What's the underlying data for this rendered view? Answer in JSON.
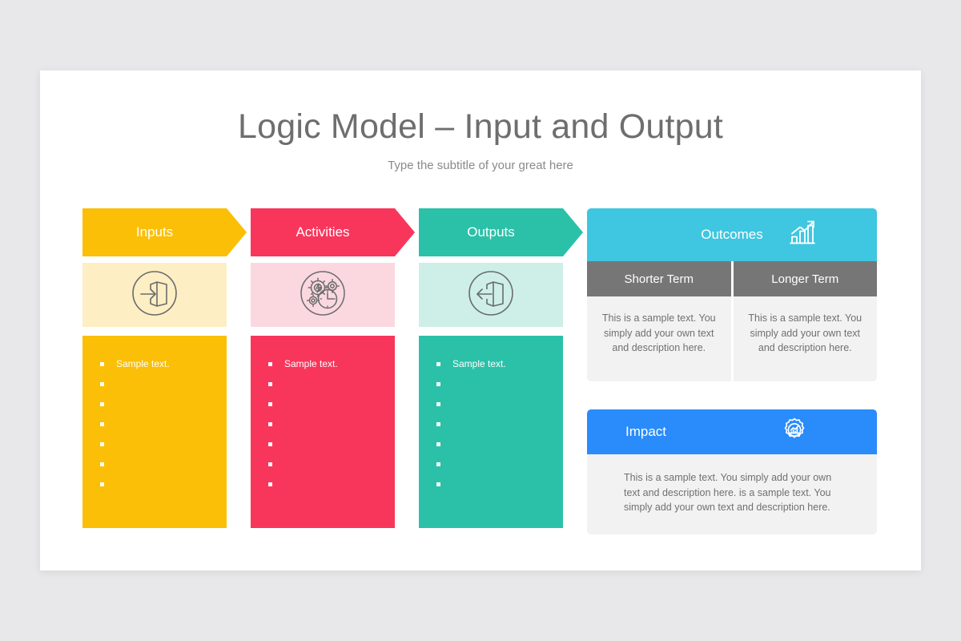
{
  "slide": {
    "title": "Logic Model – Input and Output",
    "subtitle": "Type the subtitle of your great here",
    "background_color": "#e8e8ea",
    "card_color": "#ffffff"
  },
  "columns": [
    {
      "id": "inputs",
      "title": "Inputs",
      "color": "#fbbf08",
      "tint_color": "#fdeec4",
      "icon": "enter-door-icon",
      "bullets": [
        "Sample text.",
        "",
        "",
        "",
        "",
        "",
        ""
      ]
    },
    {
      "id": "activities",
      "title": "Activities",
      "color": "#f8365c",
      "tint_color": "#fbd8e0",
      "icon": "gears-clock-icon",
      "bullets": [
        "Sample text.",
        "",
        "",
        "",
        "",
        "",
        ""
      ]
    },
    {
      "id": "outputs",
      "title": "Outputs",
      "color": "#2bc1a8",
      "tint_color": "#cdefe7",
      "icon": "exit-door-icon",
      "bullets": [
        "Sample text.",
        "",
        "",
        "",
        "",
        "",
        ""
      ]
    }
  ],
  "outcomes": {
    "title": "Outcomes",
    "color": "#3fc6e0",
    "icon": "growth-bar-chart-icon",
    "subheader_color": "#767676",
    "body_color": "#f2f2f2",
    "cells": [
      {
        "header": "Shorter Term",
        "body": "This is a sample text. You simply add your own text and description here."
      },
      {
        "header": "Longer Term",
        "body": "This is a sample text. You simply add your own text and description here."
      }
    ],
    "connector_icon": "chevron-down-icon"
  },
  "impact": {
    "title": "Impact",
    "color": "#2a8bfb",
    "icon": "gear-chart-icon",
    "body": "This is a sample text. You simply add your own text and description here. is a sample text. You simply add your own text and description here."
  }
}
